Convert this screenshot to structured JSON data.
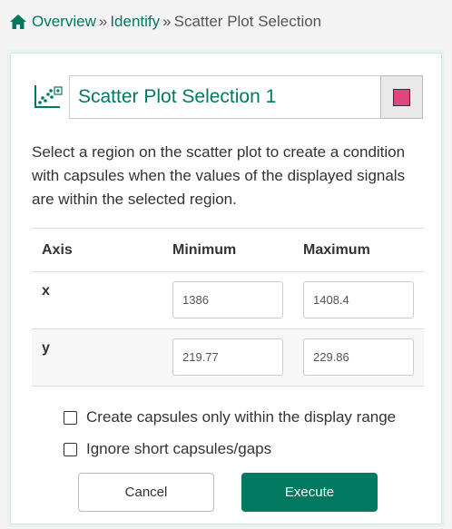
{
  "breadcrumb": {
    "items": [
      "Overview",
      "Identify"
    ],
    "separator": "»",
    "current": "Scatter Plot Selection"
  },
  "panel": {
    "title": "Scatter Plot Selection 1",
    "swatch_color": "#e0457f",
    "description": "Select a region on the scatter plot to create a condition with capsules when the values of the displayed signals are within the selected region.",
    "table": {
      "headers": [
        "Axis",
        "Minimum",
        "Maximum"
      ],
      "rows": [
        {
          "axis": "x",
          "min": "1386",
          "max": "1408.4"
        },
        {
          "axis": "y",
          "min": "219.77",
          "max": "229.86"
        }
      ]
    },
    "options": [
      {
        "label": "Create capsules only within the display range",
        "checked": false
      },
      {
        "label": "Ignore short capsules/gaps",
        "checked": false
      }
    ],
    "buttons": {
      "cancel": "Cancel",
      "execute": "Execute"
    }
  },
  "colors": {
    "accent": "#007960",
    "swatch": "#e0457f"
  }
}
